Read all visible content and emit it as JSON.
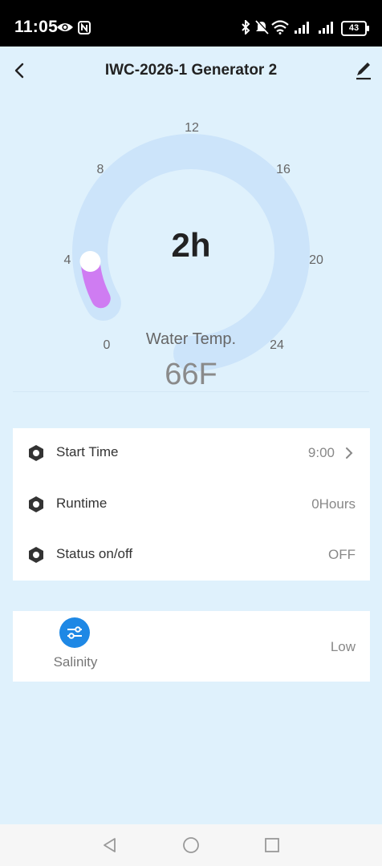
{
  "status_bar": {
    "time": "11:05",
    "battery": "43",
    "icons": [
      "eye-icon",
      "nfc-icon",
      "bluetooth-icon",
      "mute-icon",
      "wifi-icon",
      "signal-icon",
      "signal-icon",
      "battery-icon"
    ]
  },
  "header": {
    "title": "IWC-2026-1 Generator 2",
    "back_icon": "back-arrow-icon",
    "edit_icon": "edit-pencil-icon"
  },
  "gauge": {
    "ticks": [
      "0",
      "4",
      "8",
      "12",
      "16",
      "20",
      "24"
    ],
    "value": "2h",
    "level_hours": 2,
    "max_hours": 24,
    "temp_label": "Water Temp.",
    "temp_value": "66F",
    "colors": {
      "track": "#cce4fa",
      "fill": "#cf7cf2",
      "knob": "#ffffff"
    }
  },
  "settings": [
    {
      "label": "Start Time",
      "value": "9:00",
      "has_chevron": true,
      "icon": "hexagon-nut-icon"
    },
    {
      "label": "Runtime",
      "value": "0Hours",
      "has_chevron": false,
      "icon": "hexagon-nut-icon"
    },
    {
      "label": "Status on/off",
      "value": "OFF",
      "has_chevron": false,
      "icon": "hexagon-nut-icon"
    }
  ],
  "salinity": {
    "label": "Salinity",
    "value": "Low",
    "icon": "sliders-icon",
    "accent": "#1e88e5"
  },
  "navbar": {
    "icons": [
      "nav-back-icon",
      "nav-home-icon",
      "nav-recents-icon"
    ]
  }
}
